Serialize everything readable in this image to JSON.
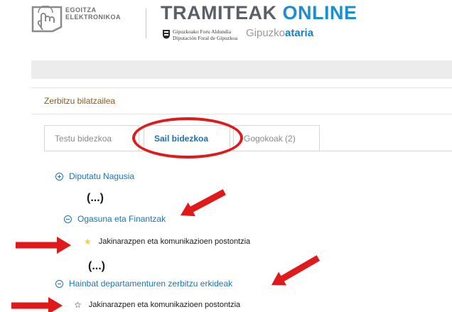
{
  "header": {
    "egoitza_line1": "EGOITZA",
    "egoitza_line2": "ELEKTRONIKOA",
    "title_part1": "TRAMITEAK",
    "title_part2": "ONLINE",
    "foru_line1": "Gipuzkoako Foru Aldundia",
    "foru_line2": "Diputación Foral de Gipuzkoa",
    "gipuzkoataria_part1": "Gipuzko",
    "gipuzkoataria_part2": "ataria"
  },
  "section": {
    "title": "Zerbitzu bilatzailea"
  },
  "tabs": [
    {
      "label": "Testu bidezkoa"
    },
    {
      "label": "Sail bidezkoa",
      "active": true
    },
    {
      "label": "Gogokoak (2)"
    }
  ],
  "tree": {
    "item1": "Diputatu Nagusia",
    "ellipsis1": "(...)",
    "item2": "Ogasuna eta Finantzak",
    "item2_child": "Jakinarazpen eta komunikazioen postontzia",
    "ellipsis2": "(...)",
    "item3": "Hainbat departamenturen zerbitzu erkideak",
    "item3_child": "Jakinarazpen eta komunikazioen postontzia"
  },
  "colors": {
    "accent_blue": "#1e73be",
    "section_title": "#8b5a1f",
    "annotation_red": "#e01a1a",
    "star_filled": "#f2d234"
  },
  "icons": {
    "expand": "plus-circle-icon",
    "collapse": "minus-circle-icon",
    "favorite_on": "star-filled-icon",
    "favorite_off": "star-outline-icon"
  }
}
